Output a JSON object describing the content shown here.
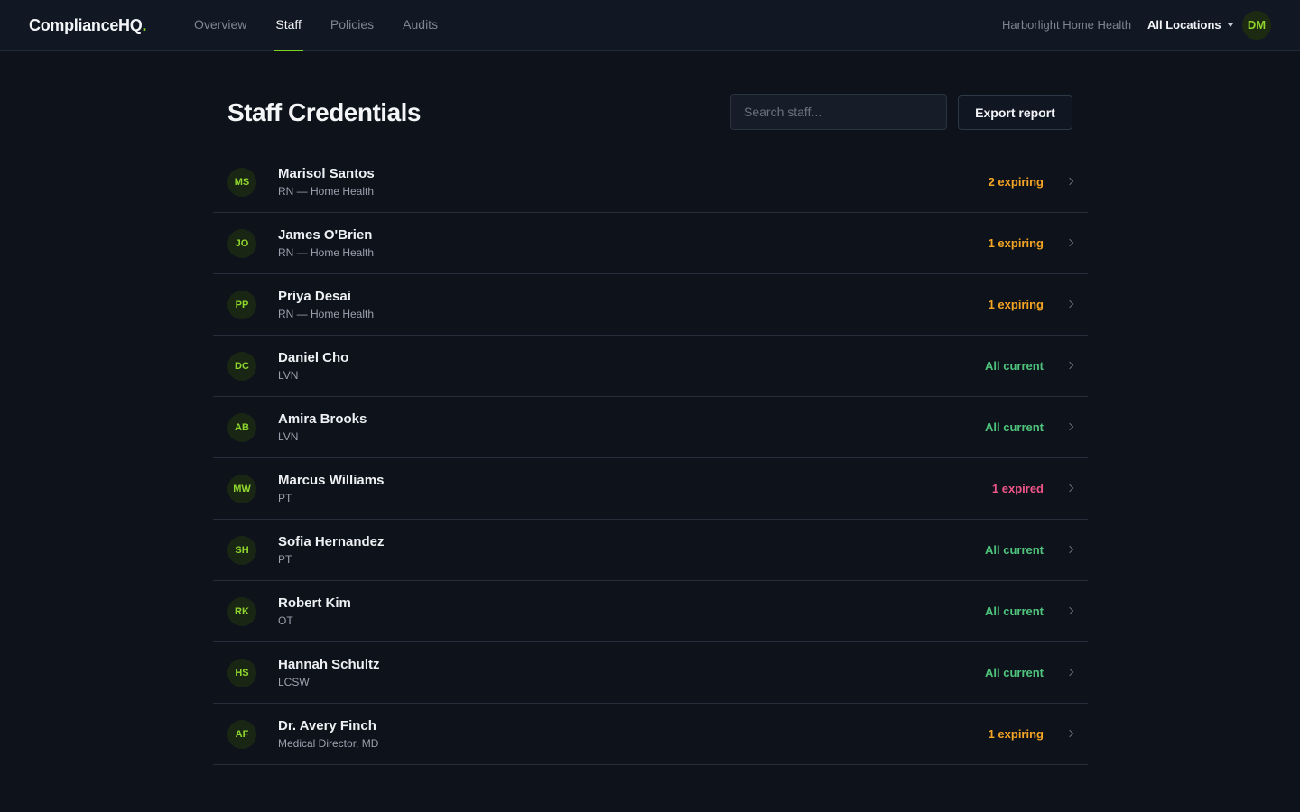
{
  "app": {
    "logo_text": "ComplianceHQ",
    "logo_dot": "."
  },
  "nav": {
    "tabs": [
      {
        "label": "Overview",
        "active": false
      },
      {
        "label": "Staff",
        "active": true
      },
      {
        "label": "Policies",
        "active": false
      },
      {
        "label": "Audits",
        "active": false
      }
    ],
    "organization": "Harborlight Home Health",
    "location_selector": "All Locations",
    "user_initials": "DM"
  },
  "page": {
    "title": "Staff Credentials",
    "search_placeholder": "Search staff...",
    "export_label": "Export report"
  },
  "staff": [
    {
      "initials": "MS",
      "name": "Marisol Santos",
      "role": "RN — Home Health",
      "status": "2 expiring",
      "status_type": "expiring"
    },
    {
      "initials": "JO",
      "name": "James O'Brien",
      "role": "RN — Home Health",
      "status": "1 expiring",
      "status_type": "expiring"
    },
    {
      "initials": "PP",
      "name": "Priya Desai",
      "role": "RN — Home Health",
      "status": "1 expiring",
      "status_type": "expiring"
    },
    {
      "initials": "DC",
      "name": "Daniel Cho",
      "role": "LVN",
      "status": "All current",
      "status_type": "current"
    },
    {
      "initials": "AB",
      "name": "Amira Brooks",
      "role": "LVN",
      "status": "All current",
      "status_type": "current"
    },
    {
      "initials": "MW",
      "name": "Marcus Williams",
      "role": "PT",
      "status": "1 expired",
      "status_type": "expired"
    },
    {
      "initials": "SH",
      "name": "Sofia Hernandez",
      "role": "PT",
      "status": "All current",
      "status_type": "current"
    },
    {
      "initials": "RK",
      "name": "Robert Kim",
      "role": "OT",
      "status": "All current",
      "status_type": "current"
    },
    {
      "initials": "HS",
      "name": "Hannah Schultz",
      "role": "LCSW",
      "status": "All current",
      "status_type": "current"
    },
    {
      "initials": "AF",
      "name": "Dr. Avery Finch",
      "role": "Medical Director, MD",
      "status": "1 expiring",
      "status_type": "expiring"
    }
  ],
  "colors": {
    "accent": "#7ed321",
    "expiring": "#f5a524",
    "current": "#4fc37c",
    "expired": "#f0558a",
    "background": "#0d121b"
  }
}
